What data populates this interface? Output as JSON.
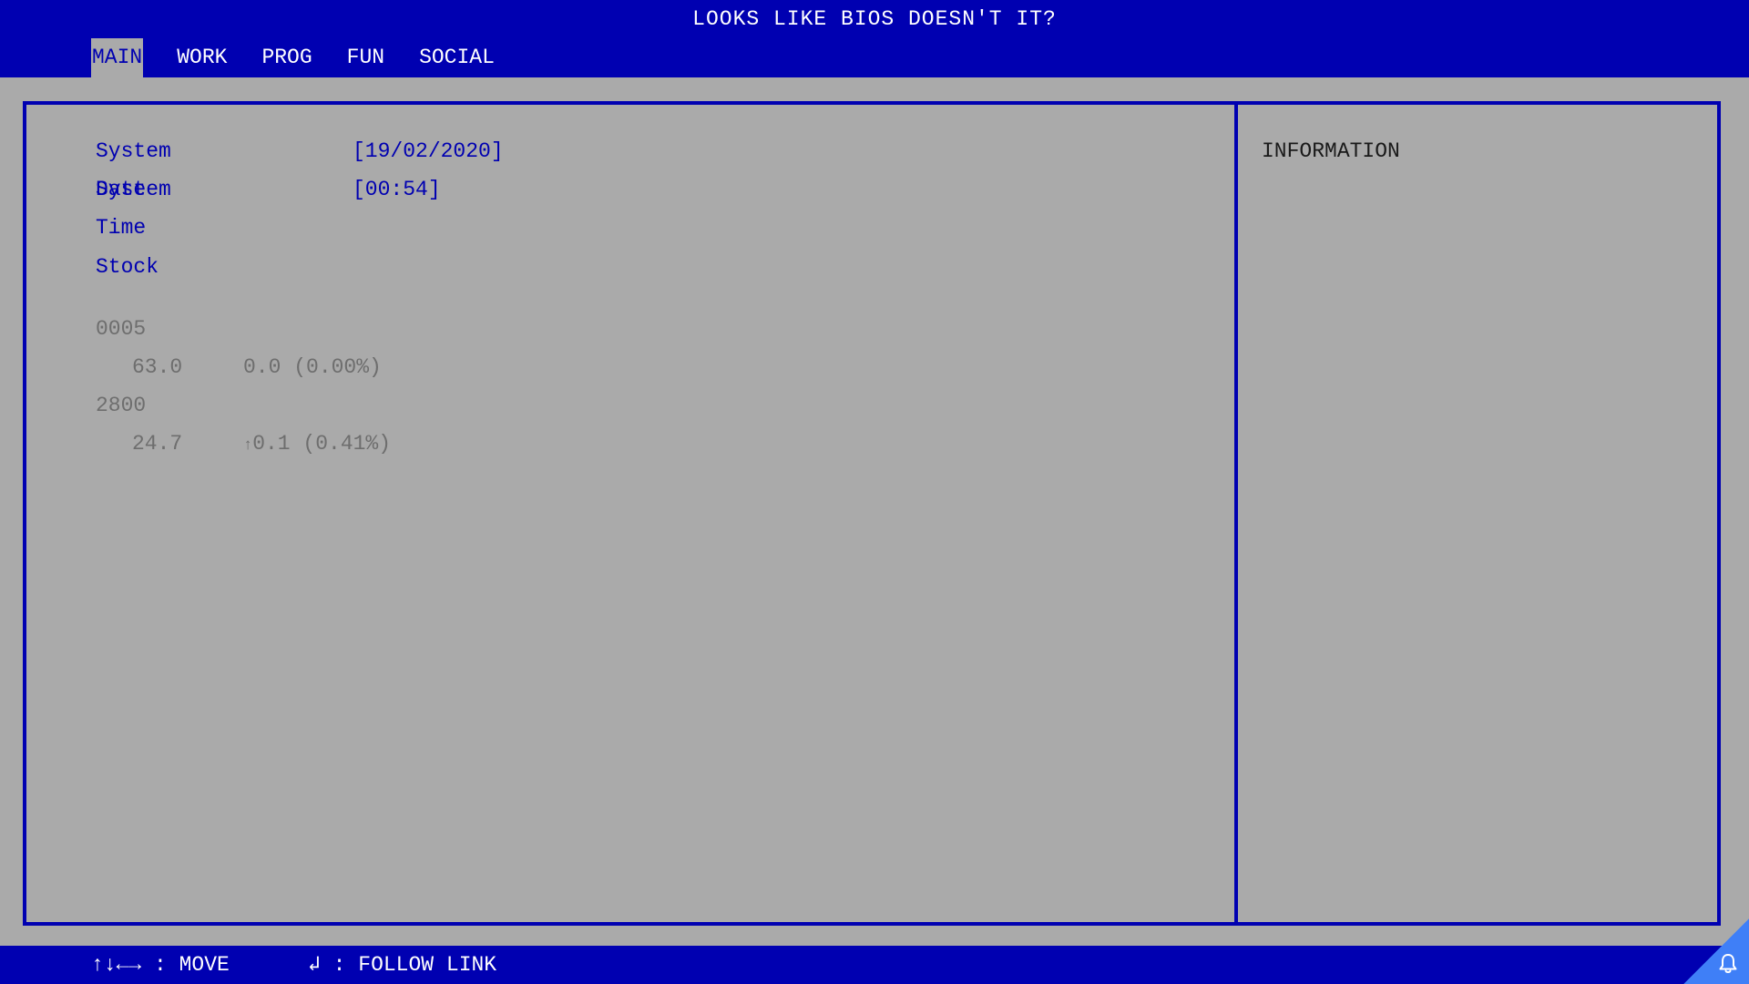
{
  "header": {
    "title": "LOOKS LIKE BIOS DOESN'T IT?"
  },
  "tabs": [
    {
      "label": "MAIN",
      "active": true
    },
    {
      "label": "WORK",
      "active": false
    },
    {
      "label": "PROG",
      "active": false
    },
    {
      "label": "FUN",
      "active": false
    },
    {
      "label": "SOCIAL",
      "active": false
    }
  ],
  "main": {
    "system_date": {
      "label": "System Date",
      "value": "[19/02/2020]"
    },
    "system_time": {
      "label": "System Time",
      "value": "[00:54]"
    },
    "stock_title": "Stock",
    "stocks": [
      {
        "code": "0005",
        "price": "63.0",
        "change": "0.0 (0.00%)",
        "direction": ""
      },
      {
        "code": "2800",
        "price": "24.7",
        "change": "0.1 (0.41%)",
        "direction": "↑"
      }
    ]
  },
  "info": {
    "title": "INFORMATION"
  },
  "footer": {
    "move_hint": "↑↓←→ : MOVE",
    "enter_symbol": "↲",
    "follow_hint": ": FOLLOW LINK"
  },
  "colors": {
    "bios_blue": "#0000b1",
    "bios_gray": "#aaaaaa",
    "corner_accent": "#3f7ff7"
  },
  "icons": {
    "corner": "bell-icon"
  }
}
